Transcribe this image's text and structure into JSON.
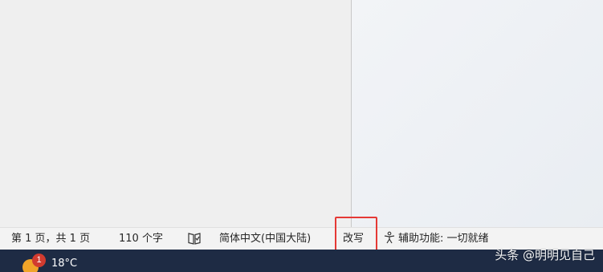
{
  "status_bar": {
    "page_info": "第 1 页，共 1 页",
    "word_count": "110 个字",
    "proofing_icon": "book-check-icon",
    "language": "简体中文(中国大陆)",
    "overtype_mode": "改写",
    "accessibility": "辅助功能: 一切就绪",
    "accessibility_icon": "accessibility-person-icon"
  },
  "highlight": {
    "color": "#e53935",
    "target": "overtype_mode"
  },
  "taskbar": {
    "weather_badge": "1",
    "temperature": "18°C",
    "weather_icon": "sun-icon",
    "background": "#1e2b44"
  },
  "watermark": {
    "text": "头条 @明明见自己"
  }
}
